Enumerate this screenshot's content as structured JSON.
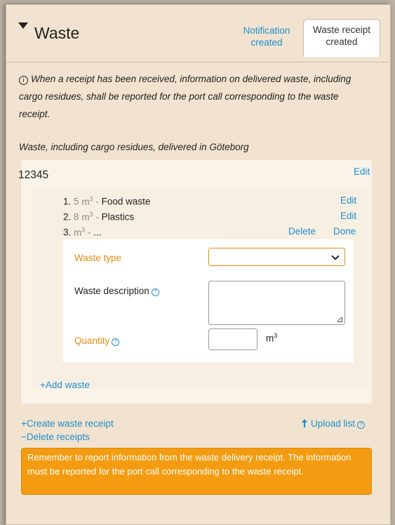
{
  "section": {
    "title": "Waste",
    "tabs": [
      {
        "label_line1": "Notification",
        "label_line2": "created"
      },
      {
        "label_line1": "Waste receipt",
        "label_line2": "created"
      }
    ]
  },
  "info": {
    "icon": "info-circle-icon",
    "text": "When a receipt has been received, information on delivered waste, including cargo residues, shall be reported for the port call corresponding to the waste receipt."
  },
  "delivered_heading": "Waste, including cargo residues, delivered in Göteborg",
  "receipt": {
    "number": "12345",
    "edit_label": "Edit",
    "items": [
      {
        "index": "1.",
        "quantity": "5",
        "unit": "m",
        "sup": "3",
        "separator": " - ",
        "type": "Food waste",
        "edit_label": "Edit"
      },
      {
        "index": "2.",
        "quantity": "8",
        "unit": "m",
        "sup": "3",
        "separator": " - ",
        "type": "Plastics",
        "edit_label": "Edit"
      },
      {
        "index": "3.",
        "quantity": "",
        "unit": "m",
        "sup": "3",
        "separator": " - ",
        "type": "...",
        "delete_label": "Delete",
        "done_label": "Done"
      }
    ],
    "form": {
      "waste_type_label": "Waste type",
      "waste_type_value": "",
      "waste_description_label": "Waste description",
      "waste_description_value": "",
      "quantity_label": "Quantity",
      "quantity_value": "",
      "unit": "m",
      "unit_sup": "3"
    },
    "add_waste_label": "Add waste"
  },
  "actions": {
    "create_receipt_label": "Create waste receipt",
    "delete_receipts_label": "Delete receipts",
    "upload_list_label": "Upload list"
  },
  "warning": "Remember to report information from the waste delivery receipt. The information must be reported for the port call corresponding to the waste receipt.",
  "colors": {
    "panel_bg": "#f1e3cf",
    "link": "#1f8fcf",
    "required_label": "#e38b15",
    "warning_bg": "#f39c12"
  }
}
